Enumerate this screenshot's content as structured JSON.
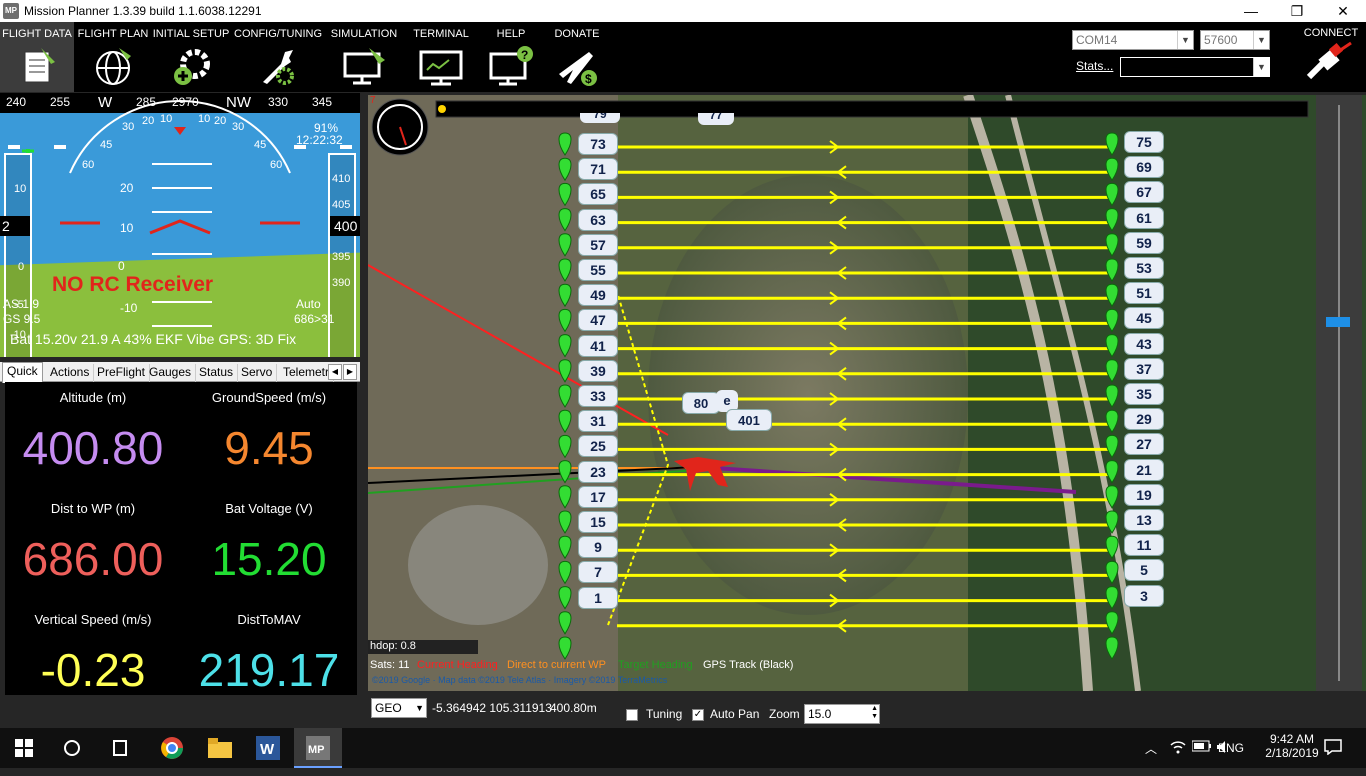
{
  "window": {
    "title": "Mission Planner 1.3.39 build 1.1.6038.12291",
    "app_icon_text": "MP",
    "minimize": "—",
    "maximize": "❐",
    "close": "✕"
  },
  "menu": {
    "items": [
      {
        "label": "FLIGHT DATA",
        "icon": "clipboard-plane-icon"
      },
      {
        "label": "FLIGHT PLAN",
        "icon": "globe-icon"
      },
      {
        "label": "INITIAL SETUP",
        "icon": "gear-plus-icon"
      },
      {
        "label": "CONFIG/TUNING",
        "icon": "wrench-gear-icon"
      },
      {
        "label": "SIMULATION",
        "icon": "monitor-plane-icon"
      },
      {
        "label": "TERMINAL",
        "icon": "terminal-monitor-icon"
      },
      {
        "label": "HELP",
        "icon": "help-monitor-icon"
      },
      {
        "label": "DONATE",
        "icon": "plane-dollar-icon"
      }
    ],
    "port": "COM14",
    "baud": "57600",
    "stats": "Stats...",
    "connect": "CONNECT"
  },
  "hud": {
    "heading_ticks": [
      "240",
      "255",
      "W",
      "285",
      "2970",
      "NW",
      "330",
      "345"
    ],
    "battery_pct": "91%",
    "time": "12:22:32",
    "speed_left": "2",
    "alt_right": "400",
    "pitch_labels": [
      "20",
      "10",
      "0",
      "-10"
    ],
    "roll_labels": [
      "60",
      "45",
      "30",
      "20",
      "10",
      "0",
      "10",
      "20",
      "30",
      "45",
      "60"
    ],
    "speed_ticks": [
      "10",
      "5",
      "0",
      "-5",
      "-10"
    ],
    "alt_ticks": [
      "410",
      "405",
      "395",
      "390"
    ],
    "no_rc": "NO RC Receiver",
    "airspeed": "AS 1.9",
    "groundspeed": "GS 9.5",
    "mode": "Auto",
    "wp_info": "686>31",
    "status_line": "Bat 15.20v 21.9 A 43% EKF  Vibe  GPS: 3D Fix"
  },
  "tabs": [
    "Quick",
    "Actions",
    "PreFlight",
    "Gauges",
    "Status",
    "Servo",
    "Telemetr"
  ],
  "quick": [
    {
      "label": "Altitude (m)",
      "value": "400.80",
      "color": "#c58cf0"
    },
    {
      "label": "GroundSpeed (m/s)",
      "value": "9.45",
      "color": "#f5872f"
    },
    {
      "label": "Dist to WP (m)",
      "value": "686.00",
      "color": "#ee5f5b"
    },
    {
      "label": "Bat Voltage (V)",
      "value": "15.20",
      "color": "#22dd33"
    },
    {
      "label": "Vertical Speed (m/s)",
      "value": "-0.23",
      "color": "#ffff55"
    },
    {
      "label": "DistToMAV",
      "value": "219.17",
      "color": "#4de0e8"
    }
  ],
  "map": {
    "waypoints_left": [
      "73",
      "71",
      "65",
      "63",
      "57",
      "55",
      "49",
      "47",
      "41",
      "39",
      "33",
      "31",
      "25",
      "23",
      "17",
      "15",
      "9",
      "7",
      "1"
    ],
    "waypoints_right": [
      "75",
      "69",
      "67",
      "61",
      "59",
      "53",
      "51",
      "45",
      "43",
      "37",
      "35",
      "29",
      "27",
      "21",
      "19",
      "13",
      "11",
      "5",
      "3"
    ],
    "top_partial": "79",
    "top_partial2": "77",
    "wp_80": "80",
    "wp_401": "401",
    "wp_e": "e",
    "hdop": "hdop: 0.8",
    "sats": "Sats: 11",
    "legend": [
      {
        "text": "Current Heading",
        "color": "#ff2020"
      },
      {
        "text": "Direct to current WP",
        "color": "#ff9020"
      },
      {
        "text": "Target Heading",
        "color": "#20a020"
      },
      {
        "text": "GPS Track (Black)",
        "color": "#ffffff"
      }
    ],
    "attribution": "©2019 Google · Map data ©2019 Tele Atlas · Imagery ©2019 TerraMetrics",
    "mini_compass_label": "7"
  },
  "status": {
    "coord_system": "GEO",
    "coords": "-5.364942 105.311913",
    "alt": "400.80m",
    "tuning": "Tuning",
    "autopan": "Auto Pan",
    "zoom_label": "Zoom",
    "zoom_value": "15.0"
  },
  "taskbar": {
    "time": "9:42 AM",
    "date": "2/18/2019",
    "lang": "ENG",
    "apps": [
      "windows-start-icon",
      "search-circle-icon",
      "task-view-icon",
      "chrome-icon",
      "file-explorer-icon",
      "word-icon",
      "mission-planner-icon"
    ]
  }
}
